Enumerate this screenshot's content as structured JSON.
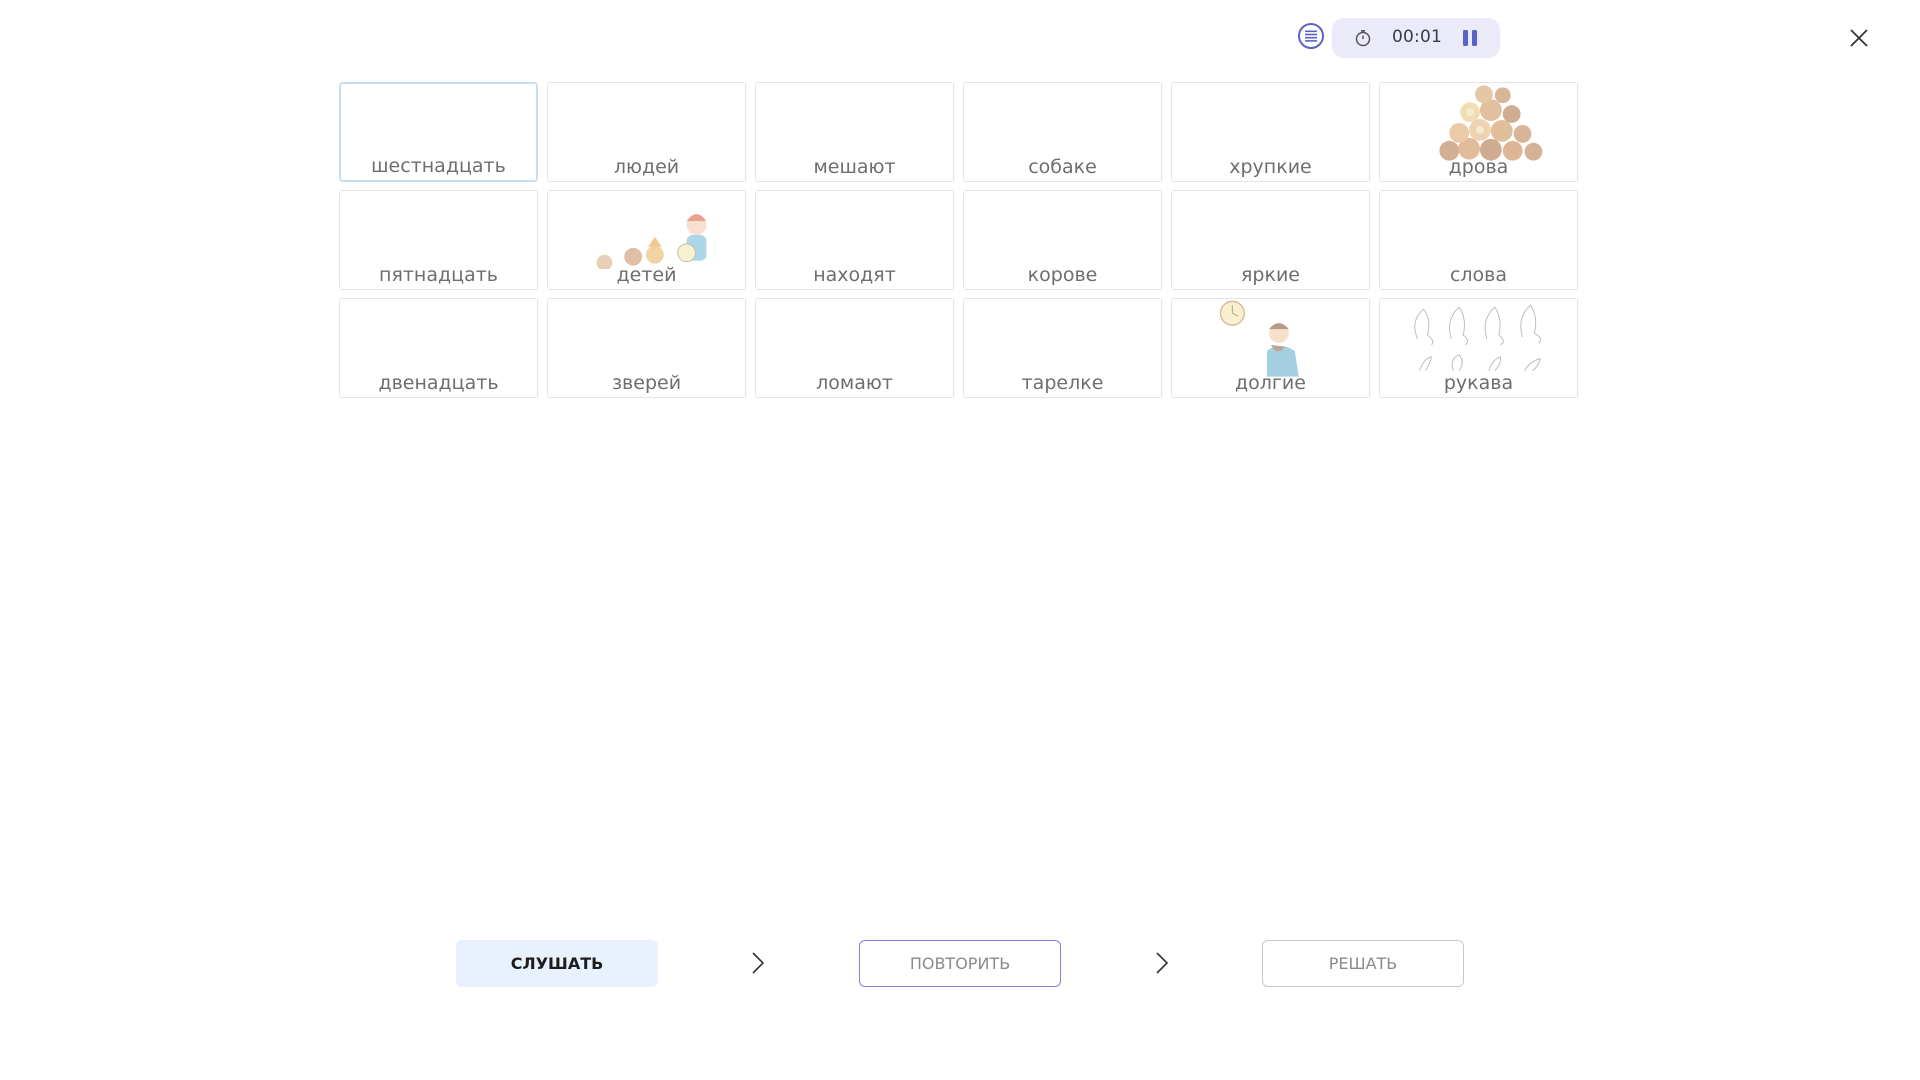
{
  "toolbar": {
    "menu_icon": "list-icon",
    "timer_icon": "stopwatch-icon",
    "time": "00:01",
    "pause_icon": "pause-icon",
    "close_icon": "close-icon"
  },
  "cards": [
    {
      "word": "шестнадцать",
      "selected": true,
      "picture": null
    },
    {
      "word": "людей",
      "picture": null
    },
    {
      "word": "мешают",
      "picture": null
    },
    {
      "word": "собаке",
      "picture": null
    },
    {
      "word": "хрупкие",
      "picture": null
    },
    {
      "word": "дрова",
      "picture": "logs-pile"
    },
    {
      "word": "пятнадцать",
      "picture": null
    },
    {
      "word": "детей",
      "picture": "children"
    },
    {
      "word": "находят",
      "picture": null
    },
    {
      "word": "корове",
      "picture": null
    },
    {
      "word": "яркие",
      "picture": null
    },
    {
      "word": "слова",
      "picture": null
    },
    {
      "word": "двенадцать",
      "picture": null
    },
    {
      "word": "зверей",
      "picture": null
    },
    {
      "word": "ломают",
      "picture": null
    },
    {
      "word": "тарелке",
      "picture": null
    },
    {
      "word": "долгие",
      "picture": "man-with-clock"
    },
    {
      "word": "рукава",
      "picture": "sleeves-sketch"
    }
  ],
  "steps": {
    "listen": "СЛУШАТЬ",
    "repeat": "ПОВТОРИТЬ",
    "solve": "РЕШАТЬ"
  },
  "colors": {
    "accent": "#5a63c9",
    "pill_bg": "#eaeaf8",
    "listen_bg": "#e9f1fc",
    "repeat_border": "#8a7fd8",
    "selected_border": "#c9ddf0"
  }
}
